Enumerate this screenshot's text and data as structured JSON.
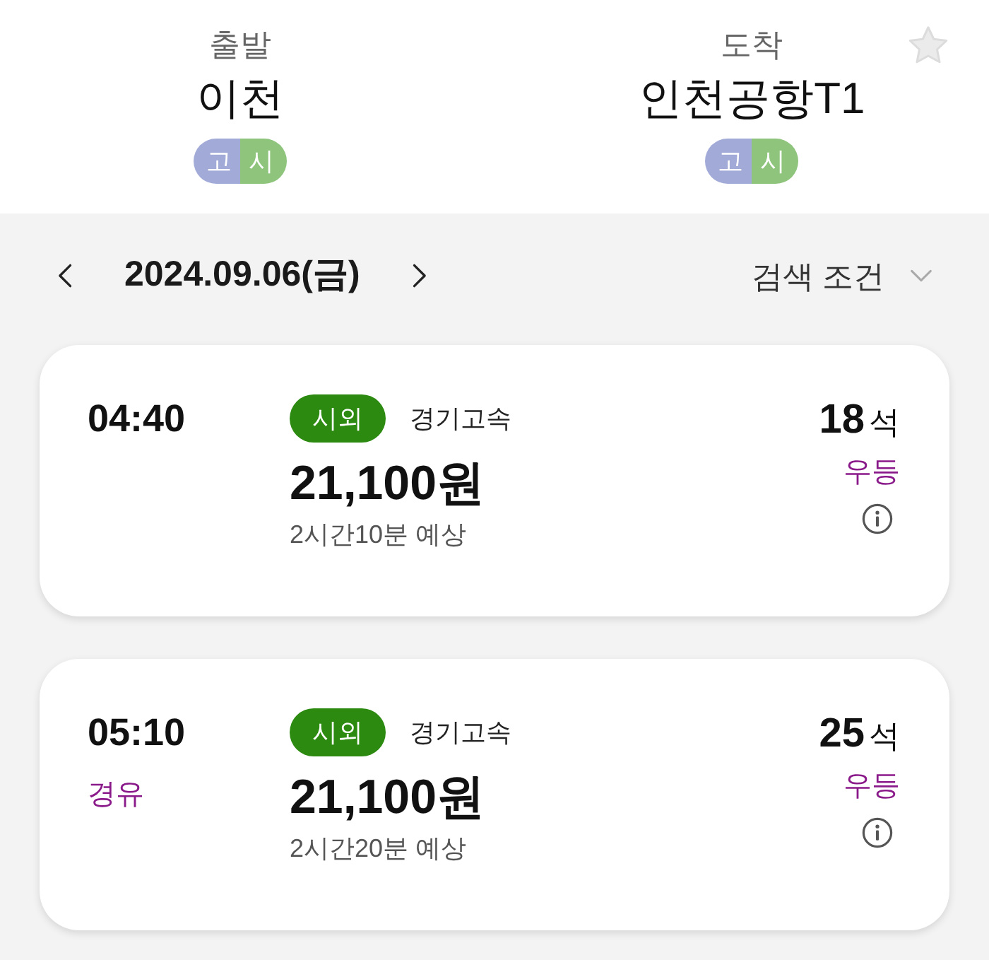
{
  "header": {
    "departure": {
      "label": "출발",
      "station": "이천",
      "badges": [
        {
          "text": "고",
          "color": "#a2abd8"
        },
        {
          "text": "시",
          "color": "#8ec47c"
        }
      ]
    },
    "arrival": {
      "label": "도착",
      "station": "인천공항T1",
      "badges": [
        {
          "text": "고",
          "color": "#a2abd8"
        },
        {
          "text": "시",
          "color": "#8ec47c"
        }
      ]
    },
    "favorite": {
      "on": false
    }
  },
  "date_bar": {
    "date": "2024.09.06(금)",
    "filter_label": "검색 조건"
  },
  "routes": [
    {
      "time": "04:40",
      "type": "시외",
      "company": "경기고속",
      "price": "21,100원",
      "duration": "2시간10분 예상",
      "seats": "18",
      "seat_unit": "석",
      "grade": "우등"
    },
    {
      "time": "05:10",
      "stopover": "경유",
      "type": "시외",
      "company": "경기고속",
      "price": "21,100원",
      "duration": "2시간20분 예상",
      "seats": "25",
      "seat_unit": "석",
      "grade": "우등"
    }
  ]
}
